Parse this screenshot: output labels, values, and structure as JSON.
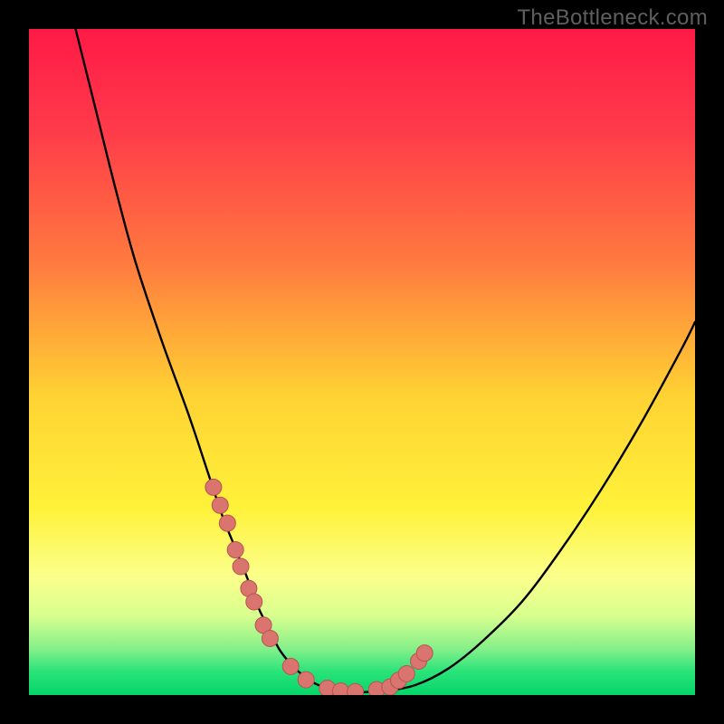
{
  "watermark": "TheBottleneck.com",
  "colors": {
    "frame": "#000000",
    "gradient_stops": [
      {
        "offset": 0.0,
        "color": "#ff1a46"
      },
      {
        "offset": 0.15,
        "color": "#ff3a4a"
      },
      {
        "offset": 0.35,
        "color": "#ff7a3f"
      },
      {
        "offset": 0.55,
        "color": "#ffd233"
      },
      {
        "offset": 0.72,
        "color": "#fff23a"
      },
      {
        "offset": 0.82,
        "color": "#fcff8a"
      },
      {
        "offset": 0.88,
        "color": "#d9ff8f"
      },
      {
        "offset": 0.93,
        "color": "#86f08a"
      },
      {
        "offset": 0.965,
        "color": "#29e37a"
      },
      {
        "offset": 1.0,
        "color": "#05d56a"
      }
    ],
    "curve": "#000000",
    "marker_fill": "#d9746f",
    "marker_stroke": "#b8534f"
  },
  "chart_data": {
    "type": "line",
    "title": "",
    "xlabel": "",
    "ylabel": "",
    "xlim": [
      0,
      100
    ],
    "ylim": [
      0,
      100
    ],
    "series": [
      {
        "name": "bottleneck-curve",
        "x": [
          7,
          10,
          13,
          16,
          20,
          24,
          27,
          29,
          31,
          33,
          34.5,
          36,
          37.5,
          39,
          40.5,
          42,
          44,
          48,
          53,
          58,
          63,
          68,
          74,
          80,
          86,
          92,
          98,
          100
        ],
        "y": [
          100,
          88,
          76,
          65,
          53,
          42,
          33,
          27,
          22,
          17,
          13,
          10,
          7,
          5,
          3.5,
          2.3,
          1.3,
          0.5,
          0.6,
          1.5,
          4,
          8,
          14,
          22,
          31,
          41,
          52,
          56
        ]
      }
    ],
    "markers": {
      "name": "highlighted-points",
      "x": [
        27.7,
        28.7,
        29.8,
        31.0,
        31.8,
        33.0,
        33.8,
        35.2,
        36.2,
        39.3,
        41.6,
        44.8,
        46.8,
        49.0,
        52.2,
        54.2,
        55.5,
        56.7,
        58.5,
        59.4
      ],
      "y": [
        31.2,
        28.5,
        25.8,
        21.8,
        19.3,
        16,
        14,
        10.5,
        8.5,
        4.3,
        2.3,
        1.0,
        0.6,
        0.5,
        0.8,
        1.2,
        2.2,
        3.2,
        5.1,
        6.3
      ]
    }
  }
}
